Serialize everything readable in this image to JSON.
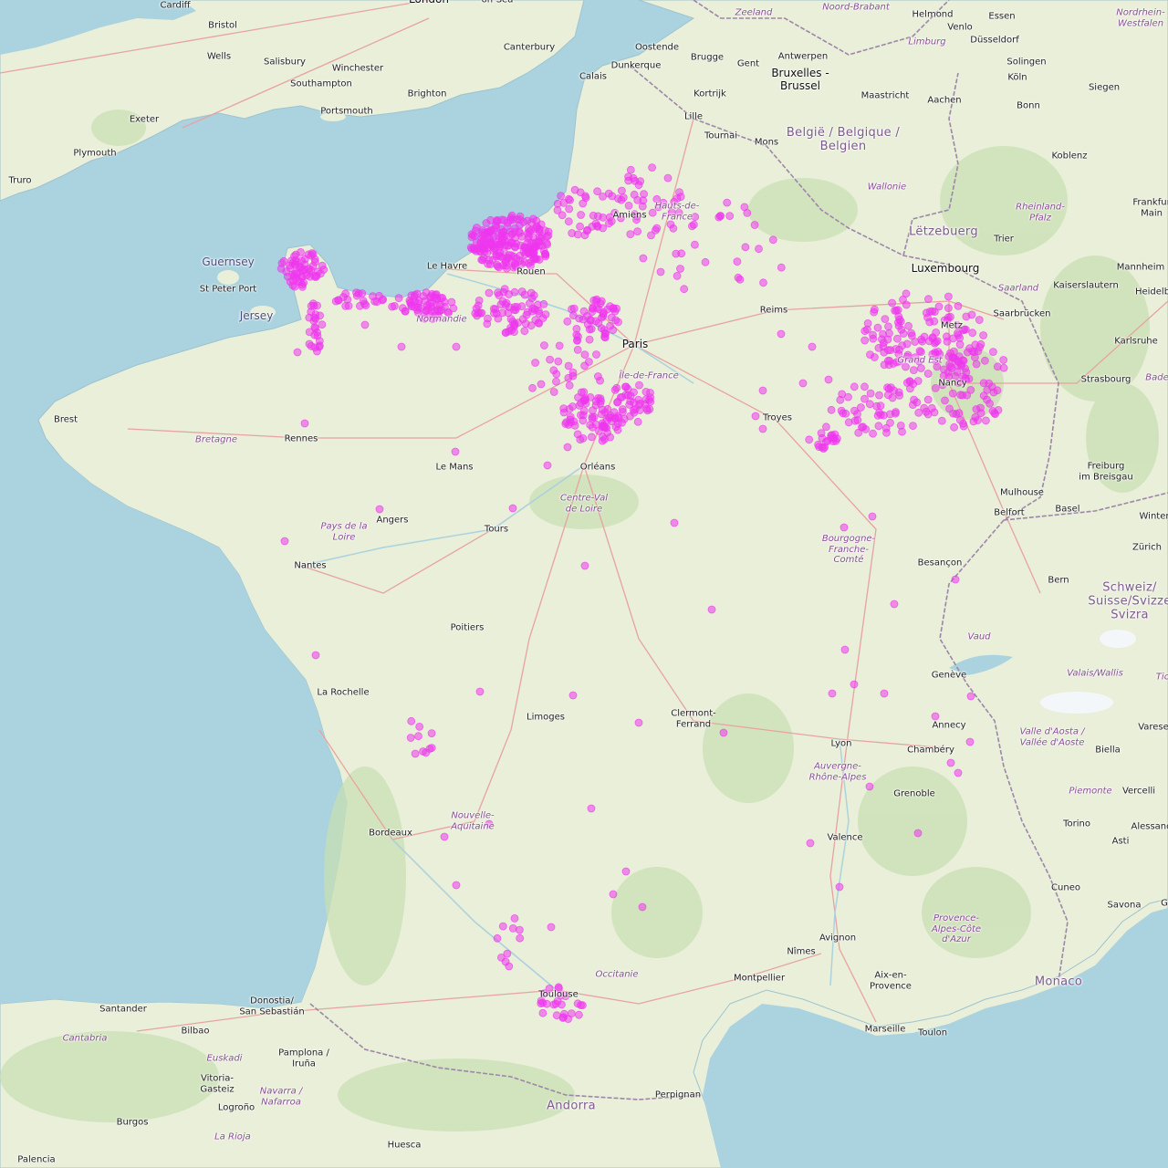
{
  "colors": {
    "water": "#aad3df",
    "land": "#e9efd9",
    "forest": "#c8dfb0",
    "road_major": "#e8a2a2",
    "border": "#9e86a8",
    "marker": "#ee36ee"
  },
  "labels": {
    "cities": [
      {
        "id": "cardiff",
        "text": "Cardiff"
      },
      {
        "id": "bristol",
        "text": "Bristol"
      },
      {
        "id": "london",
        "text": "London"
      },
      {
        "id": "wells",
        "text": "Wells"
      },
      {
        "id": "salisbury",
        "text": "Salisbury"
      },
      {
        "id": "winchester",
        "text": "Winchester"
      },
      {
        "id": "southampton",
        "text": "Southampton"
      },
      {
        "id": "portsmouth",
        "text": "Portsmouth"
      },
      {
        "id": "brighton",
        "text": "Brighton"
      },
      {
        "id": "canterbury",
        "text": "Canterbury"
      },
      {
        "id": "exeter",
        "text": "Exeter"
      },
      {
        "id": "plymouth",
        "text": "Plymouth"
      },
      {
        "id": "truro",
        "text": "Truro"
      },
      {
        "id": "stpeterport",
        "text": "St Peter Port"
      },
      {
        "id": "calais",
        "text": "Calais"
      },
      {
        "id": "dunkerque",
        "text": "Dunkerque"
      },
      {
        "id": "oostende",
        "text": "Oostende"
      },
      {
        "id": "brugge",
        "text": "Brugge"
      },
      {
        "id": "gent",
        "text": "Gent"
      },
      {
        "id": "antwerpen",
        "text": "Antwerpen"
      },
      {
        "id": "bruxelles",
        "text": "Bruxelles -\nBrussel"
      },
      {
        "id": "kortrijk",
        "text": "Kortrijk"
      },
      {
        "id": "lille",
        "text": "Lille"
      },
      {
        "id": "tournai",
        "text": "Tournai"
      },
      {
        "id": "mons",
        "text": "Mons"
      },
      {
        "id": "maastricht",
        "text": "Maastricht"
      },
      {
        "id": "aachen",
        "text": "Aachen"
      },
      {
        "id": "helmond",
        "text": "Helmond"
      },
      {
        "id": "venlo",
        "text": "Venlo"
      },
      {
        "id": "essen",
        "text": "Essen"
      },
      {
        "id": "dusseldorf",
        "text": "Düsseldorf"
      },
      {
        "id": "koln",
        "text": "Köln"
      },
      {
        "id": "bonn",
        "text": "Bonn"
      },
      {
        "id": "solingen",
        "text": "Solingen"
      },
      {
        "id": "siegen",
        "text": "Siegen"
      },
      {
        "id": "koblenz",
        "text": "Koblenz"
      },
      {
        "id": "amiens",
        "text": "Amiens"
      },
      {
        "id": "lehavre",
        "text": "Le Havre"
      },
      {
        "id": "rouen",
        "text": "Rouen"
      },
      {
        "id": "reims",
        "text": "Reims"
      },
      {
        "id": "paris",
        "text": "Paris"
      },
      {
        "id": "trier",
        "text": "Trier"
      },
      {
        "id": "luxembourg",
        "text": "Luxembourg"
      },
      {
        "id": "saarbrucken",
        "text": "Saarbrücken"
      },
      {
        "id": "kaiserslautern",
        "text": "Kaiserslautern"
      },
      {
        "id": "mannheim",
        "text": "Mannheim"
      },
      {
        "id": "heidelberg",
        "text": "Heidelb"
      },
      {
        "id": "karlsruhe",
        "text": "Karlsruhe"
      },
      {
        "id": "frankfurt",
        "text": "Frankfur\nMain"
      },
      {
        "id": "metz",
        "text": "Metz"
      },
      {
        "id": "nancy",
        "text": "Nancy"
      },
      {
        "id": "strasbourg",
        "text": "Strasbourg"
      },
      {
        "id": "brest",
        "text": "Brest"
      },
      {
        "id": "rennes",
        "text": "Rennes"
      },
      {
        "id": "lemans",
        "text": "Le Mans"
      },
      {
        "id": "orleans",
        "text": "Orléans"
      },
      {
        "id": "troyes",
        "text": "Troyes"
      },
      {
        "id": "freiburg",
        "text": "Freiburg\nim Breisgau"
      },
      {
        "id": "mulhouse",
        "text": "Mulhouse"
      },
      {
        "id": "basel",
        "text": "Basel"
      },
      {
        "id": "belfort",
        "text": "Belfort"
      },
      {
        "id": "winter",
        "text": "Winter"
      },
      {
        "id": "zurich",
        "text": "Zürich"
      },
      {
        "id": "angers",
        "text": "Angers"
      },
      {
        "id": "tours",
        "text": "Tours"
      },
      {
        "id": "nantes",
        "text": "Nantes"
      },
      {
        "id": "besancon",
        "text": "Besançon"
      },
      {
        "id": "bern",
        "text": "Bern"
      },
      {
        "id": "poitiers",
        "text": "Poitiers"
      },
      {
        "id": "larochelle",
        "text": "La Rochelle"
      },
      {
        "id": "limoges",
        "text": "Limoges"
      },
      {
        "id": "clermont",
        "text": "Clermont-\nFerrand"
      },
      {
        "id": "geneve",
        "text": "Genève"
      },
      {
        "id": "annecy",
        "text": "Annecy"
      },
      {
        "id": "lyon",
        "text": "Lyon"
      },
      {
        "id": "chambery",
        "text": "Chambéry"
      },
      {
        "id": "biella",
        "text": "Biella"
      },
      {
        "id": "vercelli",
        "text": "Vercelli"
      },
      {
        "id": "grenoble",
        "text": "Grenoble"
      },
      {
        "id": "bordeaux",
        "text": "Bordeaux"
      },
      {
        "id": "valence",
        "text": "Valence"
      },
      {
        "id": "torino",
        "text": "Torino"
      },
      {
        "id": "asti",
        "text": "Asti"
      },
      {
        "id": "alessand",
        "text": "Alessand"
      },
      {
        "id": "cuneo",
        "text": "Cuneo"
      },
      {
        "id": "savona",
        "text": "Savona"
      },
      {
        "id": "avignon",
        "text": "Avignon"
      },
      {
        "id": "nimes",
        "text": "Nîmes"
      },
      {
        "id": "montpellier",
        "text": "Montpellier"
      },
      {
        "id": "aix",
        "text": "Aix-en-\nProvence"
      },
      {
        "id": "marseille",
        "text": "Marseille"
      },
      {
        "id": "toulon",
        "text": "Toulon"
      },
      {
        "id": "toulouse",
        "text": "Toulouse"
      },
      {
        "id": "santander",
        "text": "Santander"
      },
      {
        "id": "bilbao",
        "text": "Bilbao"
      },
      {
        "id": "donostia",
        "text": "Donostia/\nSan Sebastián"
      },
      {
        "id": "pamplona",
        "text": "Pamplona /\nIruña"
      },
      {
        "id": "vitoria",
        "text": "Vitoria-\nGasteiz"
      },
      {
        "id": "logrono",
        "text": "Logroño"
      },
      {
        "id": "burgos",
        "text": "Burgos"
      },
      {
        "id": "huesca",
        "text": "Huesca"
      },
      {
        "id": "perpignan",
        "text": "Perpignan"
      },
      {
        "id": "palencia",
        "text": "Palencia"
      },
      {
        "id": "varese",
        "text": "Varese"
      },
      {
        "id": "onsea",
        "text": "on-Sea"
      },
      {
        "id": "g",
        "text": "G"
      }
    ],
    "regions": [
      {
        "id": "zeeland",
        "text": "Zeeland"
      },
      {
        "id": "noordbrabant",
        "text": "Noord-Brabant"
      },
      {
        "id": "limburg",
        "text": "Limburg"
      },
      {
        "id": "nrw",
        "text": "Nordrhein-\nWestfalen"
      },
      {
        "id": "wallonie",
        "text": "Wallonie"
      },
      {
        "id": "hautsdefrance",
        "text": "Hauts-de-\nFrance"
      },
      {
        "id": "rheinland",
        "text": "Rheinland-\nPfalz"
      },
      {
        "id": "saarland",
        "text": "Saarland"
      },
      {
        "id": "normandie",
        "text": "Normandie"
      },
      {
        "id": "iledefrance",
        "text": "Île-de-France"
      },
      {
        "id": "grandest",
        "text": "Grand Est"
      },
      {
        "id": "bade",
        "text": "Bade"
      },
      {
        "id": "bretagne",
        "text": "Bretagne"
      },
      {
        "id": "centre",
        "text": "Centre-Val\nde Loire"
      },
      {
        "id": "pdl",
        "text": "Pays de la\nLoire"
      },
      {
        "id": "bfc",
        "text": "Bourgogne-\nFranche-\nComté"
      },
      {
        "id": "vaud",
        "text": "Vaud"
      },
      {
        "id": "valais",
        "text": "Valais/Wallis"
      },
      {
        "id": "ticino",
        "text": "Tic"
      },
      {
        "id": "aosta",
        "text": "Valle d'Aosta /\nVallée d'Aoste"
      },
      {
        "id": "ara",
        "text": "Auvergne-\nRhône-Alpes"
      },
      {
        "id": "piemonte",
        "text": "Piemonte"
      },
      {
        "id": "nouvelleaquitaine",
        "text": "Nouvelle-\nAquitaine"
      },
      {
        "id": "paca",
        "text": "Provence-\nAlpes-Côte\nd'Azur"
      },
      {
        "id": "occitanie",
        "text": "Occitanie"
      },
      {
        "id": "cantabria",
        "text": "Cantabria"
      },
      {
        "id": "euskadi",
        "text": "Euskadi"
      },
      {
        "id": "navarra",
        "text": "Navarra /\nNafarroa"
      },
      {
        "id": "larioja",
        "text": "La Rioja"
      }
    ],
    "countries": [
      {
        "id": "belgique",
        "text": "België / Belgique /\nBelgien"
      },
      {
        "id": "letzebuerg",
        "text": "Lëtzebuerg"
      },
      {
        "id": "schweiz",
        "text": "Schweiz/\nSuisse/Svizze\nSvizra"
      },
      {
        "id": "andorra",
        "text": "Andorra"
      },
      {
        "id": "monaco",
        "text": "Monaco"
      }
    ],
    "islands": [
      {
        "id": "guernsey",
        "text": "Guernsey"
      },
      {
        "id": "jersey",
        "text": "Jersey"
      }
    ]
  }
}
